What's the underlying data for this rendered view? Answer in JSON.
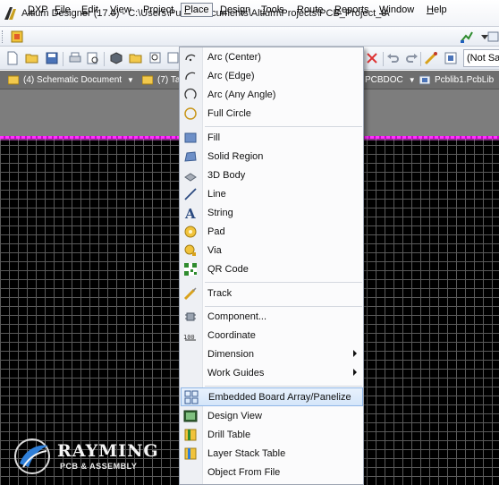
{
  "window": {
    "title": "Altium Designer (17.0) - C:\\Users\\Public\\Documents\\Altium\\Projects\\PCB_Project_8\\"
  },
  "menubar": {
    "items": [
      {
        "label": "DXP",
        "key": "D",
        "rest": "XP"
      },
      {
        "label": "File",
        "key": "F",
        "rest": "ile"
      },
      {
        "label": "Edit",
        "key": "E",
        "rest": "dit"
      },
      {
        "label": "View",
        "key": "V",
        "rest": "iew"
      },
      {
        "label": "Project",
        "key": "",
        "rest": "Project"
      },
      {
        "label": "Place",
        "key": "P",
        "rest": "lace"
      },
      {
        "label": "Design",
        "key": "D",
        "rest": "esign"
      },
      {
        "label": "Tools",
        "key": "T",
        "rest": "ools"
      },
      {
        "label": "Route",
        "key": "",
        "rest": "Route"
      },
      {
        "label": "Reports",
        "key": "R",
        "rest": "eports"
      },
      {
        "label": "Window",
        "key": "W",
        "rest": "indow"
      },
      {
        "label": "Help",
        "key": "H",
        "rest": "elp"
      }
    ]
  },
  "toolbar": {
    "not_saved": "(Not Sa"
  },
  "doc_tabs": [
    {
      "label": "(4) Schematic Document",
      "icon": "schematic-icon"
    },
    {
      "label": "(7) Ta",
      "icon": "table-icon"
    },
    {
      "label": "PCBDOC",
      "icon": "pcb-icon"
    },
    {
      "label": "Pcblib1.PcbLib",
      "icon": "pcblib-icon"
    }
  ],
  "place_menu": {
    "items": [
      {
        "label": "Arc (Center)",
        "icon": "arc-center-icon",
        "submenu": false
      },
      {
        "label": "Arc (Edge)",
        "icon": "arc-edge-icon",
        "submenu": false
      },
      {
        "label": "Arc (Any Angle)",
        "icon": "arc-any-angle-icon",
        "submenu": false
      },
      {
        "label": "Full Circle",
        "icon": "full-circle-icon",
        "submenu": false
      },
      {
        "label": "Fill",
        "icon": "fill-icon",
        "submenu": false
      },
      {
        "label": "Solid Region",
        "icon": "solid-region-icon",
        "submenu": false
      },
      {
        "label": "3D Body",
        "icon": "3d-body-icon",
        "submenu": false
      },
      {
        "label": "Line",
        "icon": "line-icon",
        "submenu": false
      },
      {
        "label": "String",
        "icon": "string-icon",
        "submenu": false
      },
      {
        "label": "Pad",
        "icon": "pad-icon",
        "submenu": false
      },
      {
        "label": "Via",
        "icon": "via-icon",
        "submenu": false
      },
      {
        "label": "QR Code",
        "icon": "qr-code-icon",
        "submenu": false
      },
      {
        "label": "Track",
        "icon": "track-icon",
        "submenu": false
      },
      {
        "label": "Component...",
        "icon": "component-icon",
        "submenu": false
      },
      {
        "label": "Coordinate",
        "icon": "coordinate-icon",
        "submenu": false
      },
      {
        "label": "Dimension",
        "icon": "",
        "submenu": true
      },
      {
        "label": "Work Guides",
        "icon": "",
        "submenu": true
      },
      {
        "label": "Embedded Board Array/Panelize",
        "icon": "embedded-board-array-icon",
        "submenu": false,
        "highlighted": true
      },
      {
        "label": "Design View",
        "icon": "design-view-icon",
        "submenu": false
      },
      {
        "label": "Drill Table",
        "icon": "drill-table-icon",
        "submenu": false
      },
      {
        "label": "Layer Stack Table",
        "icon": "layer-stack-table-icon",
        "submenu": false
      },
      {
        "label": "Object From File",
        "icon": "",
        "submenu": false
      }
    ]
  },
  "watermark": {
    "brand": "RAYMING",
    "tagline": "PCB & ASSEMBLY"
  },
  "colors": {
    "board_outline": "#ff33ff",
    "grid": "#5a5a5a",
    "highlight": "#d5e6fa"
  }
}
